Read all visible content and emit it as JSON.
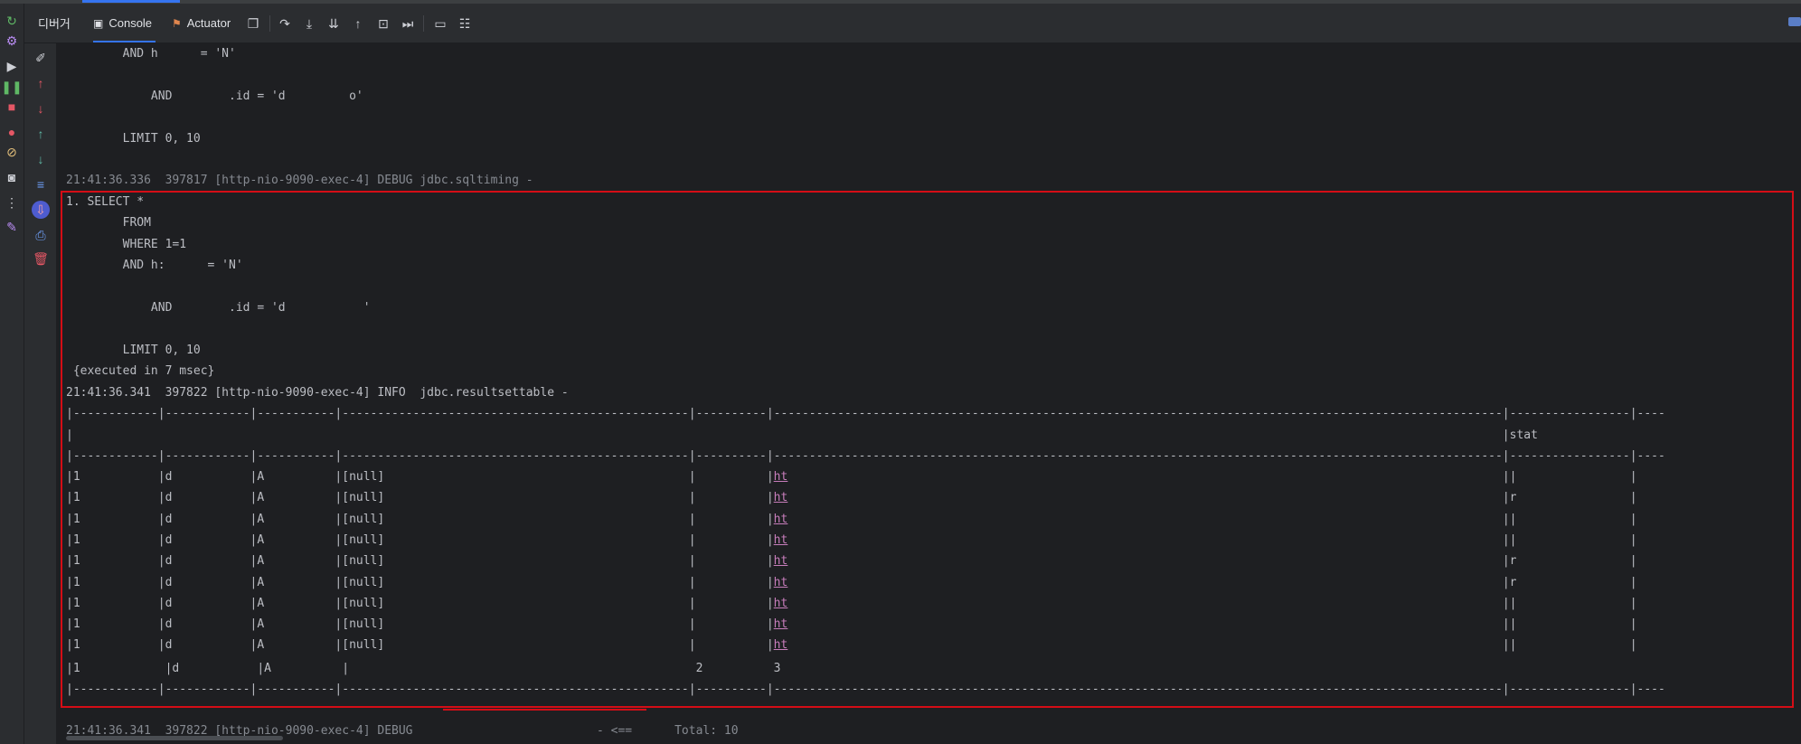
{
  "tabs": [
    {
      "label": "디버거",
      "icon": "debugger-icon"
    },
    {
      "label": "Console",
      "icon": "console-icon",
      "active": true
    },
    {
      "label": "Actuator",
      "icon": "actuator-icon"
    }
  ],
  "toolbar_icons": [
    "restore-layout-icon",
    "step-over-icon",
    "step-into-icon",
    "force-step-into-icon",
    "step-out-icon",
    "run-to-cursor-icon",
    "evaluate-icon",
    "terminal-icon",
    "frames-icon"
  ],
  "left_strip_icons": [
    "rerun-icon",
    "settings-icon",
    "resume-icon",
    "pause-icon",
    "stop-icon",
    "view-breakpoints-icon",
    "mute-breakpoints-icon",
    "camera-icon",
    "more-icon",
    "pin-icon"
  ],
  "tool_strip_icons": [
    "clear-icon",
    "up-red-icon",
    "down-red-icon",
    "up-green-icon",
    "down-green-icon",
    "soft-wrap-icon",
    "scroll-to-end-icon",
    "print-icon",
    "delete-icon"
  ],
  "console": {
    "lines_top": [
      "        AND h      = 'N'",
      "",
      "            AND        .id = 'd         o'",
      "",
      "        LIMIT 0, 10",
      "",
      "21:41:36.336  397817 [http-nio-9090-exec-4] DEBUG jdbc.sqltiming -"
    ],
    "lines_box": [
      "1. SELECT *",
      "        FROM",
      "        WHERE 1=1",
      "        AND h:      = 'N'",
      "",
      "            AND        .id = 'd           '",
      "",
      "        LIMIT 0, 10",
      " {executed in 7 msec}",
      "21:41:36.341  397822 [http-nio-9090-exec-4] INFO  jdbc.resultsettable -",
      "|------------|------------|-----------|-------------------------------------------------|----------|-------------------------------------------------------------------------------------------------------|-----------------|----",
      "|                                                                                                                                                                                                          |stat",
      "|------------|------------|-----------|-------------------------------------------------|----------|-------------------------------------------------------------------------------------------------------|-----------------|----"
    ],
    "table_rows": [
      {
        "c1": "1",
        "c2": "d",
        "c3": "A",
        "c4": "[null]",
        "c5": "",
        "c6": "ht",
        "c7": "|"
      },
      {
        "c1": "1",
        "c2": "d",
        "c3": "A",
        "c4": "[null]",
        "c5": "",
        "c6": "ht",
        "c7": "r"
      },
      {
        "c1": "1",
        "c2": "d",
        "c3": "A",
        "c4": "[null]",
        "c5": "",
        "c6": "ht",
        "c7": "|"
      },
      {
        "c1": "1",
        "c2": "d",
        "c3": "A",
        "c4": "[null]",
        "c5": "",
        "c6": "ht",
        "c7": "|"
      },
      {
        "c1": "1",
        "c2": "d",
        "c3": "A",
        "c4": "[null]",
        "c5": "",
        "c6": "ht",
        "c7": "r"
      },
      {
        "c1": "1",
        "c2": "d",
        "c3": "A",
        "c4": "[null]",
        "c5": "",
        "c6": "ht",
        "c7": "r"
      },
      {
        "c1": "1",
        "c2": "d",
        "c3": "A",
        "c4": "[null]",
        "c5": "",
        "c6": "ht",
        "c7": "|"
      },
      {
        "c1": "1",
        "c2": "d",
        "c3": "A",
        "c4": "[null]",
        "c5": "",
        "c6": "ht",
        "c7": "|"
      },
      {
        "c1": "1",
        "c2": "d",
        "c3": "A",
        "c4": "[null]",
        "c5": "",
        "c6": "ht",
        "c7": "|"
      }
    ],
    "row_last": "|1            |d           |A          |                                                 2          3",
    "table_bottom": "|------------|------------|-----------|-------------------------------------------------|----------|-------------------------------------------------------------------------------------------------------|-----------------|----",
    "line_after": "21:41:36.341  397822 [http-nio-9090-exec-4] DEBUG                          - <==      Total: 10"
  },
  "colors": {
    "highlight": "#d40d16",
    "link": "#c77dbb",
    "background": "#1e1f22",
    "accent": "#3574f0"
  }
}
